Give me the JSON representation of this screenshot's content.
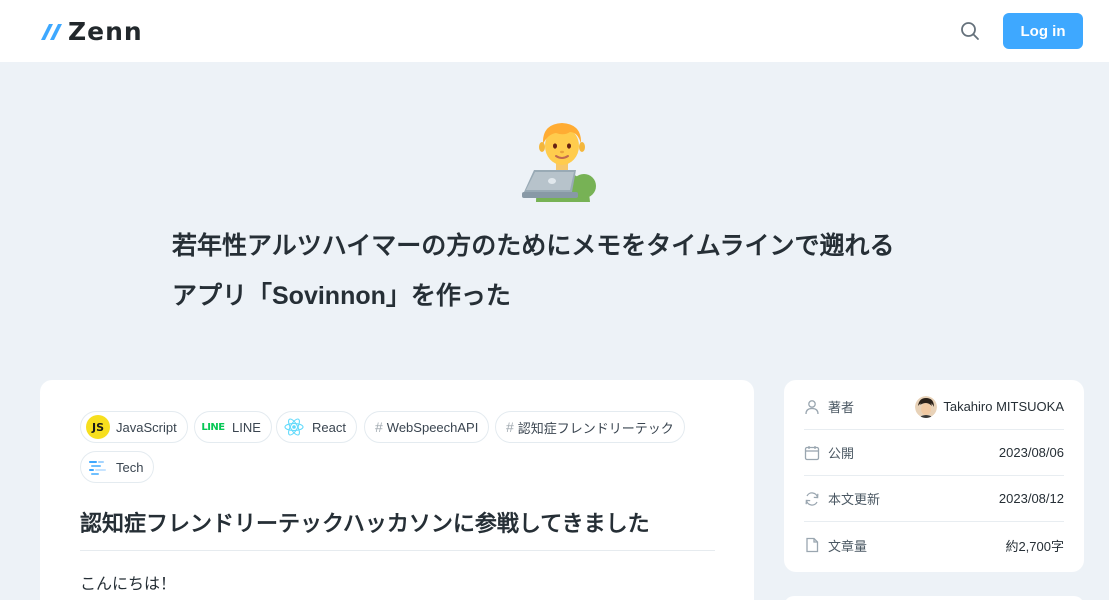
{
  "header": {
    "logo_text": "Zenn",
    "login_label": "Log in",
    "brand_color": "#3ea8ff"
  },
  "hero": {
    "emoji_icon": "technologist-emoji",
    "title_line1": "若年性アルツハイマーの方のためにメモをタイムラインで遡れる",
    "title_line2": "アプリ「Sovinnon」を作った"
  },
  "article": {
    "tags": [
      {
        "label": "JavaScript",
        "icon": "javascript-logo-icon"
      },
      {
        "label": "LINE",
        "icon": "line-logo-icon"
      },
      {
        "label": "React",
        "icon": "react-logo-icon"
      },
      {
        "label": "WebSpeechAPI",
        "icon": "hash-icon"
      },
      {
        "label": "認知症フレンドリーテック",
        "icon": "hash-icon"
      },
      {
        "label": "Tech",
        "icon": "tech-icon"
      }
    ],
    "heading": "認知症フレンドリーテックハッカソンに参戦してきました",
    "first_paragraph": "こんにちは！"
  },
  "info": {
    "author_label": "著者",
    "author_name": "Takahiro MITSUOKA",
    "published_label": "公開",
    "published_date": "2023/08/06",
    "updated_label": "本文更新",
    "updated_date": "2023/08/12",
    "length_label": "文章量",
    "length_value": "約2,700字"
  }
}
